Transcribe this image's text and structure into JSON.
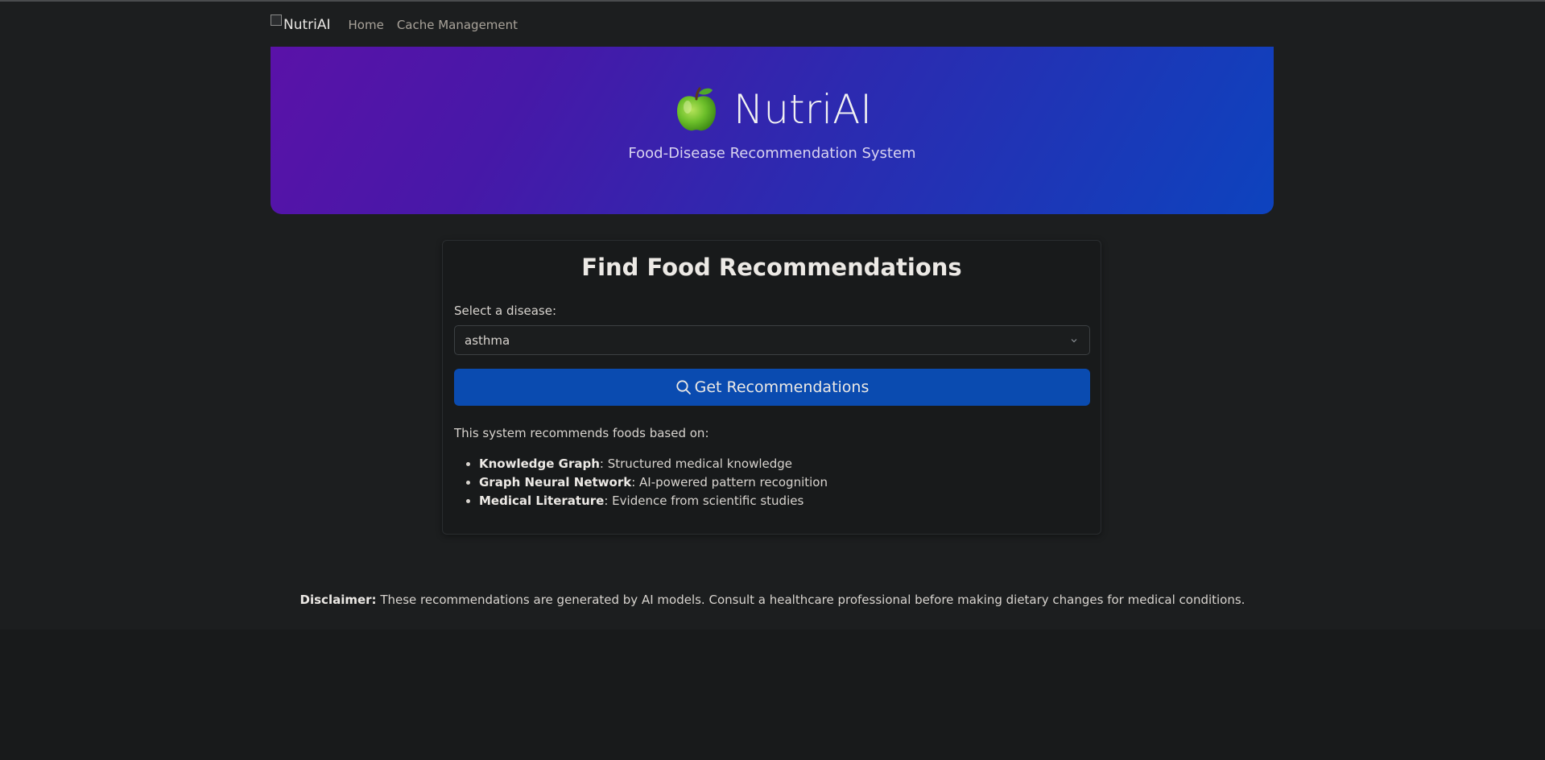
{
  "navbar": {
    "brand_alt": "NutriAI",
    "links": [
      "Home",
      "Cache Management"
    ]
  },
  "hero": {
    "icon": "green-apple-icon",
    "title": "NutriAI",
    "subtitle": "Food-Disease Recommendation System"
  },
  "card": {
    "title": "Find Food Recommendations",
    "select_label": "Select a disease:",
    "selected_disease": "asthma",
    "button_label": "Get Recommendations",
    "info_text": "This system recommends foods based on:",
    "sources": [
      {
        "name": "Knowledge Graph",
        "desc": ": Structured medical knowledge"
      },
      {
        "name": "Graph Neural Network",
        "desc": ": AI-powered pattern recognition"
      },
      {
        "name": "Medical Literature",
        "desc": ": Evidence from scientific studies"
      }
    ]
  },
  "footer": {
    "disclaimer_label": "Disclaimer:",
    "disclaimer_text": " These recommendations are generated by AI models. Consult a healthcare professional before making dietary changes for medical conditions."
  },
  "colors": {
    "background": "#1c1e1f",
    "hero_gradient_start": "#5a12a8",
    "hero_gradient_end": "#0d43be",
    "button": "#0a4bb0"
  }
}
